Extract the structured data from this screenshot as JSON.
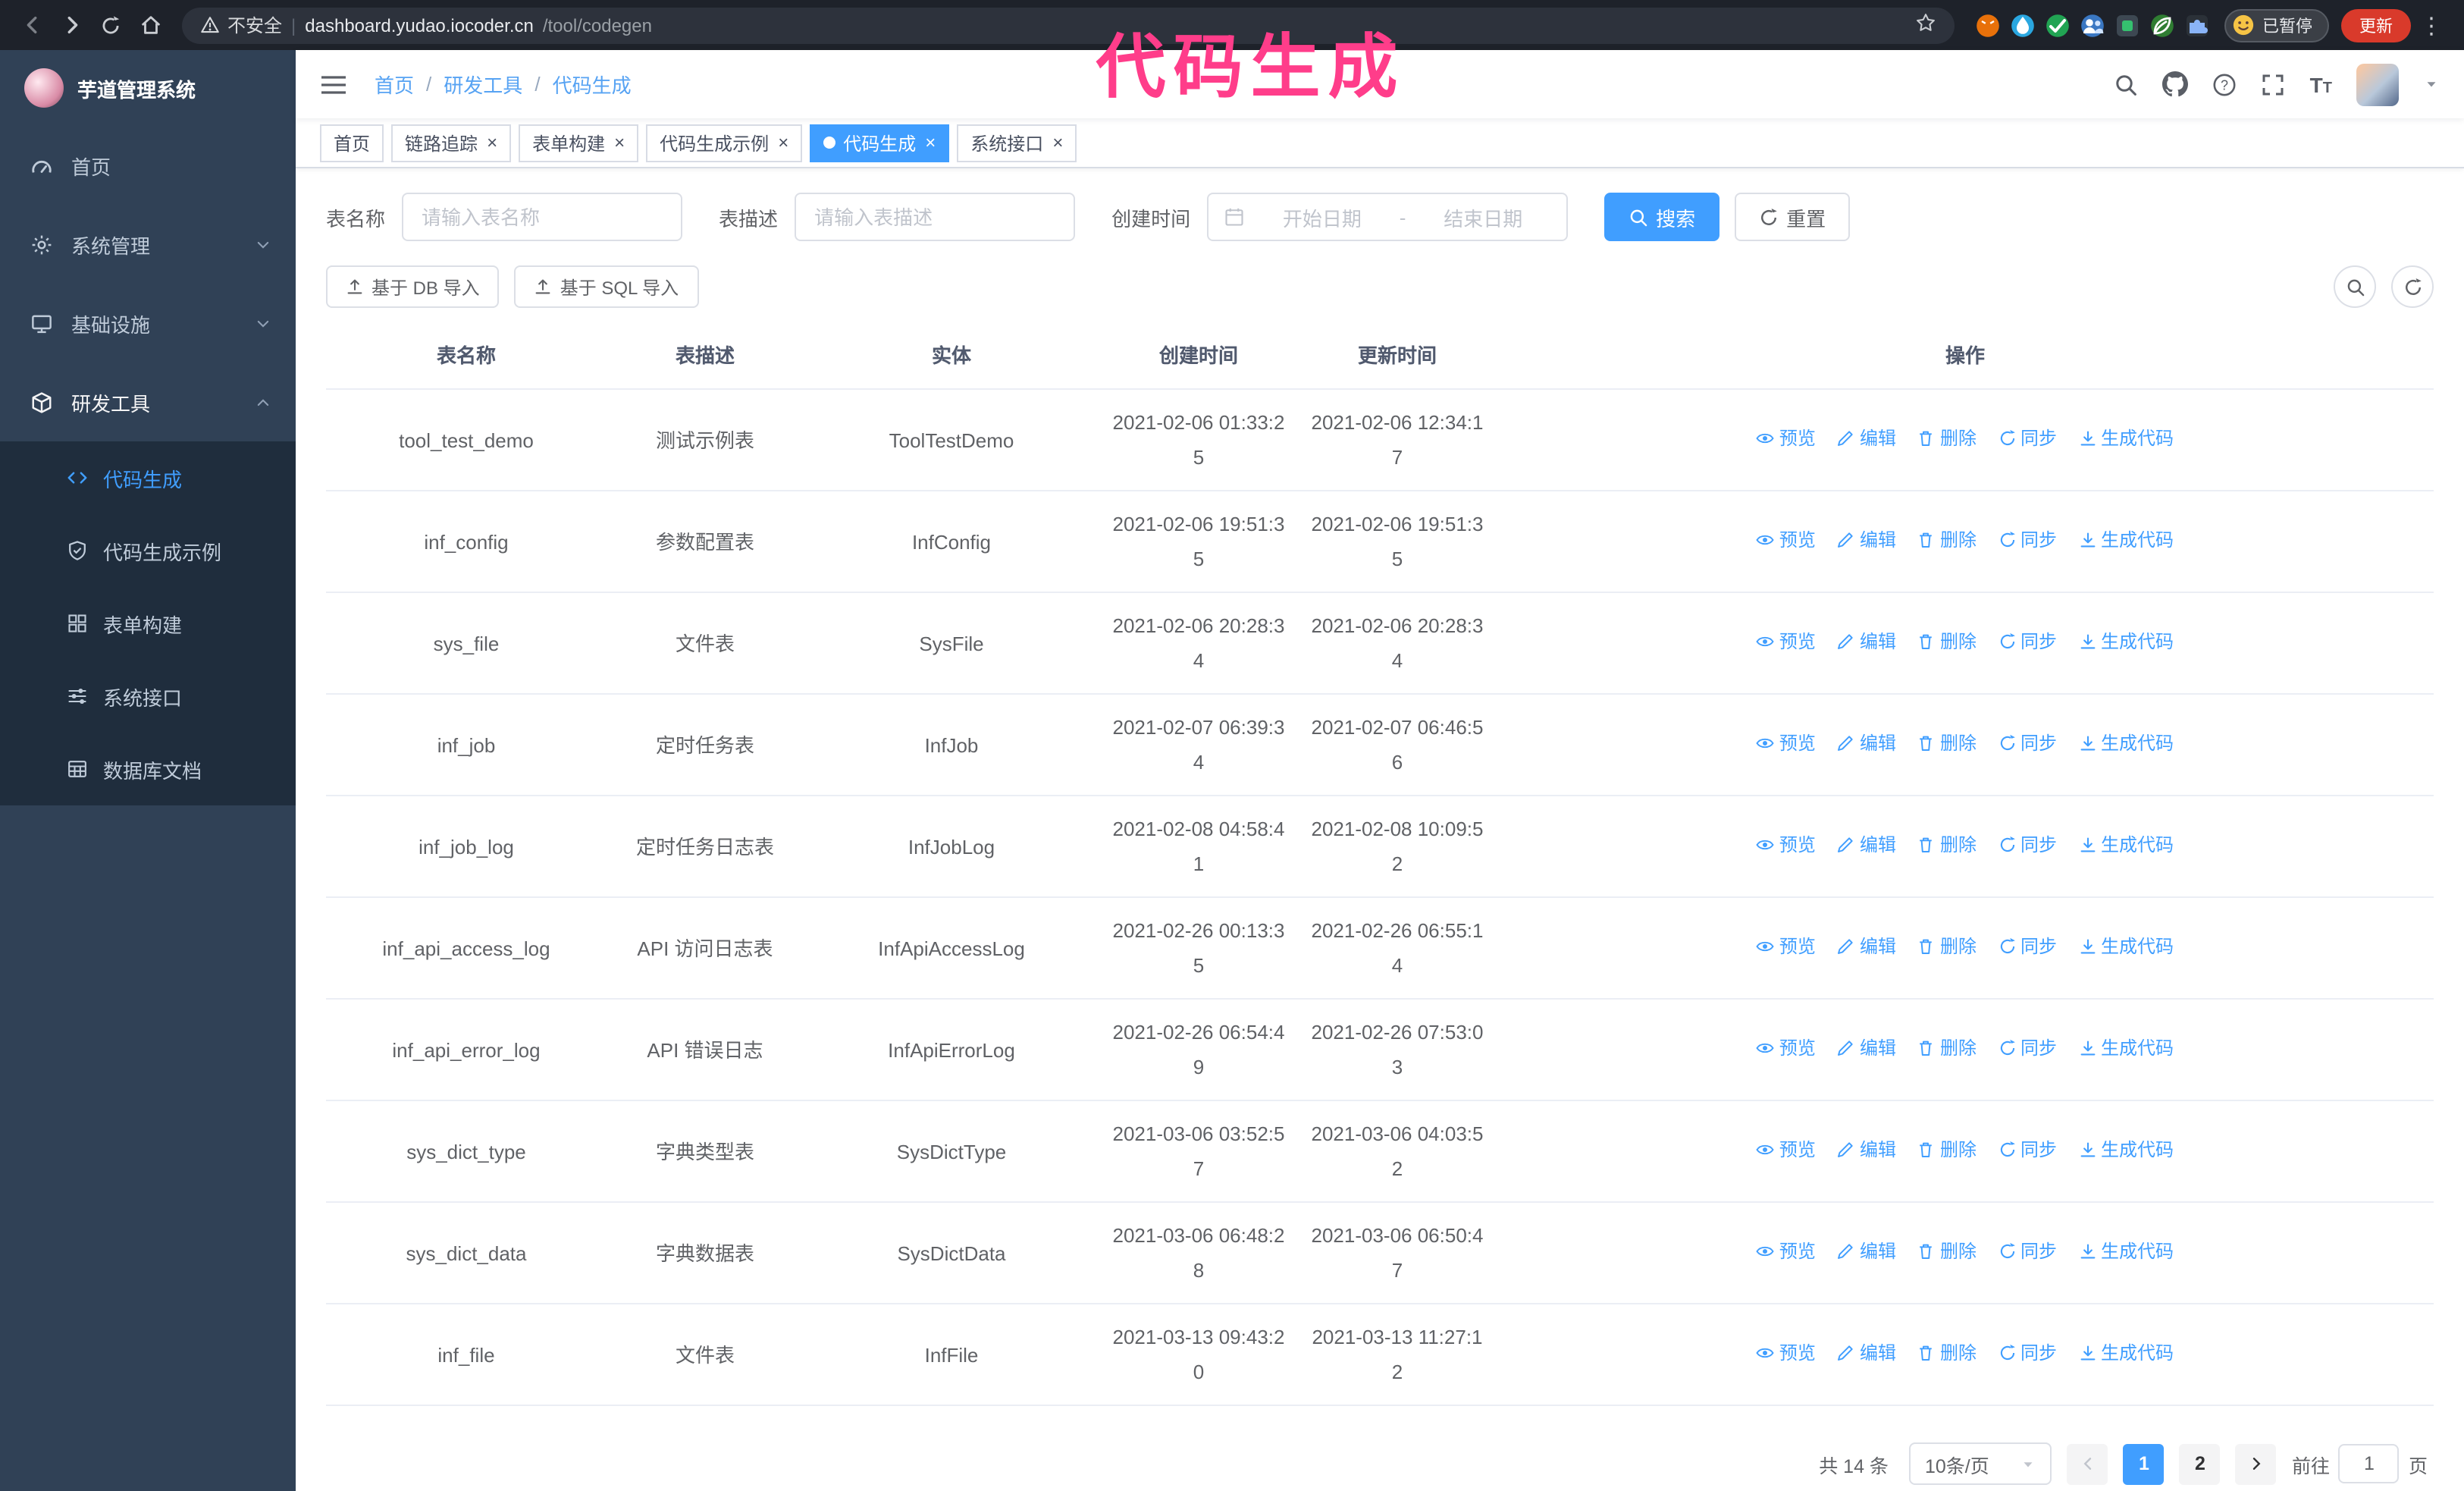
{
  "glyphs": {
    "close": "×",
    "more": "⋮",
    "url_separator": "|"
  },
  "browser": {
    "security_label": "不安全",
    "url_host": "dashboard.yudao.iocoder.cn",
    "url_path": "/tool/codegen",
    "paused_badge": "已暂停",
    "update_button": "更新"
  },
  "annotation": {
    "text": "代码生成"
  },
  "sidebar": {
    "logo_title": "芋道管理系统",
    "items": [
      {
        "label": "首页"
      },
      {
        "label": "系统管理"
      },
      {
        "label": "基础设施"
      },
      {
        "label": "研发工具"
      }
    ],
    "subitems": [
      {
        "label": "代码生成"
      },
      {
        "label": "代码生成示例"
      },
      {
        "label": "表单构建"
      },
      {
        "label": "系统接口"
      },
      {
        "label": "数据库文档"
      }
    ]
  },
  "breadcrumb": {
    "items": [
      "首页",
      "研发工具",
      "代码生成"
    ],
    "separator": "/"
  },
  "tabs": [
    {
      "label": "首页"
    },
    {
      "label": "链路追踪"
    },
    {
      "label": "表单构建"
    },
    {
      "label": "代码生成示例"
    },
    {
      "label": "代码生成"
    },
    {
      "label": "系统接口"
    }
  ],
  "filters": {
    "table_name_label": "表名称",
    "table_name_placeholder": "请输入表名称",
    "table_desc_label": "表描述",
    "table_desc_placeholder": "请输入表描述",
    "create_time_label": "创建时间",
    "date_start_placeholder": "开始日期",
    "date_separator": "-",
    "date_end_placeholder": "结束日期",
    "search_button": "搜索",
    "reset_button": "重置"
  },
  "toolbar": {
    "import_db_button": "基于 DB 导入",
    "import_sql_button": "基于 SQL 导入"
  },
  "table": {
    "columns": [
      "表名称",
      "表描述",
      "实体",
      "创建时间",
      "更新时间",
      "操作"
    ],
    "actions": {
      "preview": "预览",
      "edit": "编辑",
      "delete": "删除",
      "sync": "同步",
      "generate": "生成代码"
    },
    "rows": [
      {
        "name": "tool_test_demo",
        "desc": "测试示例表",
        "entity": "ToolTestDemo",
        "created": "2021-02-06 01:33:25",
        "updated": "2021-02-06 12:34:17"
      },
      {
        "name": "inf_config",
        "desc": "参数配置表",
        "entity": "InfConfig",
        "created": "2021-02-06 19:51:35",
        "updated": "2021-02-06 19:51:35"
      },
      {
        "name": "sys_file",
        "desc": "文件表",
        "entity": "SysFile",
        "created": "2021-02-06 20:28:34",
        "updated": "2021-02-06 20:28:34"
      },
      {
        "name": "inf_job",
        "desc": "定时任务表",
        "entity": "InfJob",
        "created": "2021-02-07 06:39:34",
        "updated": "2021-02-07 06:46:56"
      },
      {
        "name": "inf_job_log",
        "desc": "定时任务日志表",
        "entity": "InfJobLog",
        "created": "2021-02-08 04:58:41",
        "updated": "2021-02-08 10:09:52"
      },
      {
        "name": "inf_api_access_log",
        "desc": "API 访问日志表",
        "entity": "InfApiAccessLog",
        "created": "2021-02-26 00:13:35",
        "updated": "2021-02-26 06:55:14"
      },
      {
        "name": "inf_api_error_log",
        "desc": "API 错误日志",
        "entity": "InfApiErrorLog",
        "created": "2021-02-26 06:54:49",
        "updated": "2021-02-26 07:53:03"
      },
      {
        "name": "sys_dict_type",
        "desc": "字典类型表",
        "entity": "SysDictType",
        "created": "2021-03-06 03:52:57",
        "updated": "2021-03-06 04:03:52"
      },
      {
        "name": "sys_dict_data",
        "desc": "字典数据表",
        "entity": "SysDictData",
        "created": "2021-03-06 06:48:28",
        "updated": "2021-03-06 06:50:47"
      },
      {
        "name": "inf_file",
        "desc": "文件表",
        "entity": "InfFile",
        "created": "2021-03-13 09:43:20",
        "updated": "2021-03-13 11:27:12"
      }
    ]
  },
  "pagination": {
    "total": "共 14 条",
    "page_size": "10条/页",
    "pages": [
      "1",
      "2"
    ],
    "goto_label": "前往",
    "goto_value": "1",
    "goto_suffix": "页"
  }
}
